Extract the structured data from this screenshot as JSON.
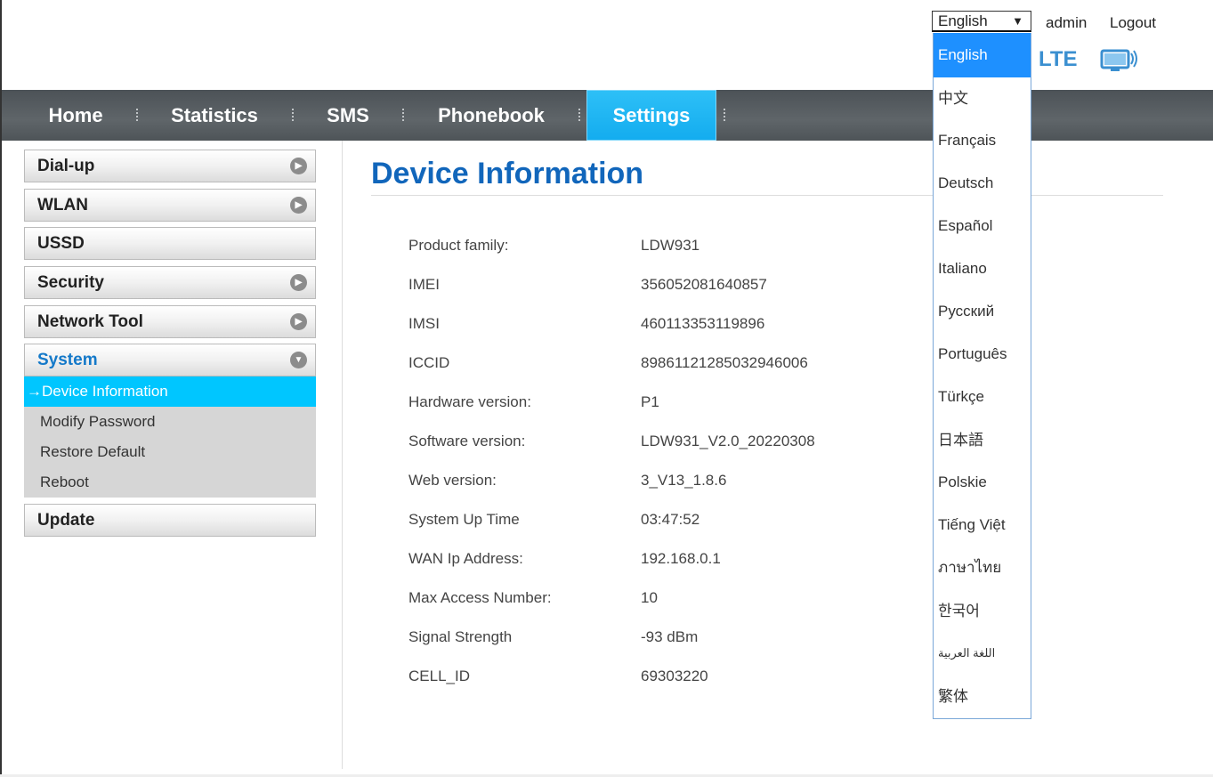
{
  "header": {
    "language_selected": "English",
    "user_label": "admin",
    "logout_label": "Logout",
    "network_type": "LTE",
    "accent_color": "#3a8fd0"
  },
  "nav": {
    "items": [
      "Home",
      "Statistics",
      "SMS",
      "Phonebook",
      "Settings"
    ],
    "active": "Settings",
    "active_color": "#1fb6f4"
  },
  "sidebar": {
    "items": [
      "Dial-up",
      "WLAN",
      "USSD",
      "Security",
      "Network Tool",
      "System",
      "Update"
    ],
    "open_item": "System",
    "submenu": [
      "Device Information",
      "Modify Password",
      "Restore Default",
      "Reboot"
    ],
    "active_sub": "Device Information",
    "active_prefix": "→"
  },
  "main": {
    "title": "Device Information",
    "rows": [
      {
        "label": "Product family:",
        "value": "LDW931"
      },
      {
        "label": "IMEI",
        "value": "356052081640857"
      },
      {
        "label": "IMSI",
        "value": "460113353119896"
      },
      {
        "label": "ICCID",
        "value": "89861121285032946006"
      },
      {
        "label": "Hardware version:",
        "value": "P1"
      },
      {
        "label": "Software version:",
        "value": "LDW931_V2.0_20220308"
      },
      {
        "label": "Web version:",
        "value": "3_V13_1.8.6"
      },
      {
        "label": "System Up Time",
        "value": "03:47:52"
      },
      {
        "label": "WAN Ip Address:",
        "value": "192.168.0.1"
      },
      {
        "label": "Max Access Number:",
        "value": "10"
      },
      {
        "label": "Signal Strength",
        "value": "-93 dBm"
      },
      {
        "label": "CELL_ID",
        "value": "69303220"
      }
    ]
  },
  "language_dropdown": {
    "options": [
      "English",
      "中文",
      "Français",
      "Deutsch",
      "Español",
      "Italiano",
      "Русский",
      "Português",
      "Türkçe",
      "日本語",
      "Polskie",
      "Tiếng Việt",
      "ภาษาไทย",
      "한국어",
      "اللغة العربية",
      "繁体"
    ],
    "selected": "English",
    "highlight_color": "#1e90ff"
  },
  "icons": {
    "dropdown_caret": "▼",
    "expand_icon": "▶",
    "collapse_icon": "▼",
    "monitor": "monitor-signal-icon"
  }
}
